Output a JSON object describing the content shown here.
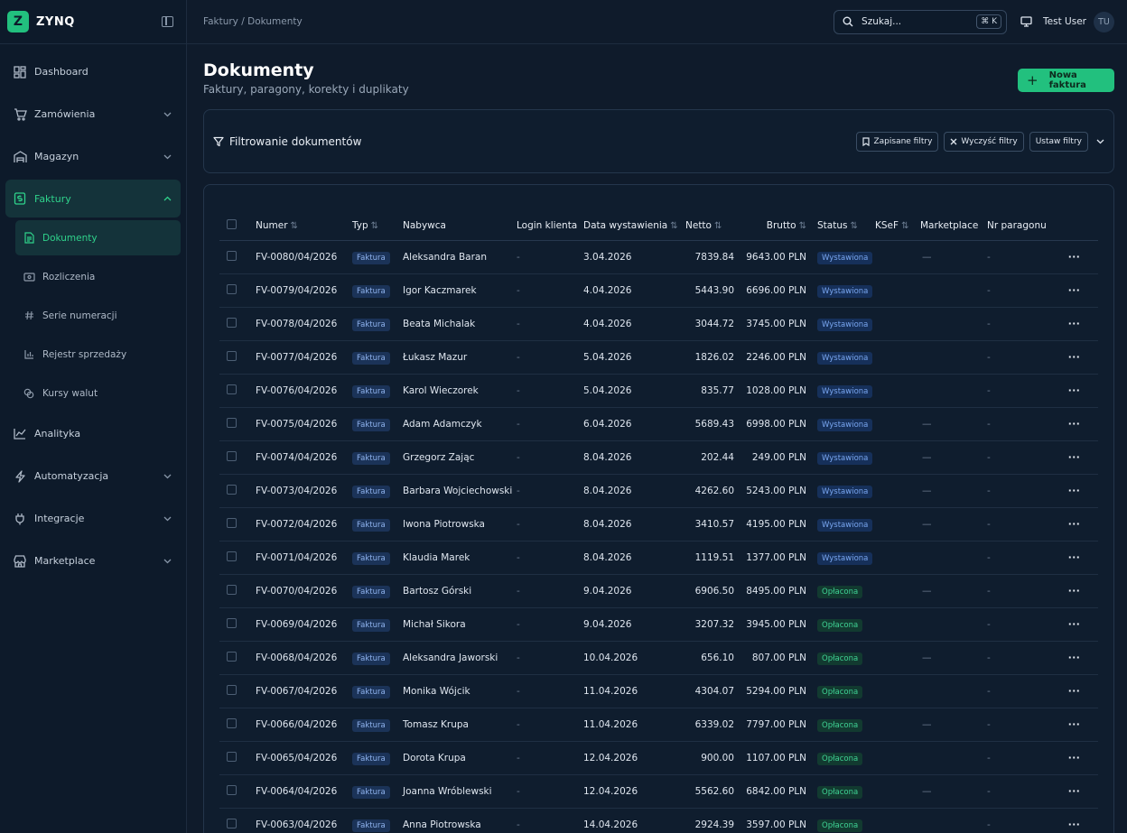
{
  "brand": {
    "logo_letter": "Z",
    "name": "ZYNQ"
  },
  "sidebar": {
    "items": [
      {
        "label": "Dashboard"
      },
      {
        "label": "Zamówienia"
      },
      {
        "label": "Magazyn"
      },
      {
        "label": "Faktury"
      },
      {
        "label": "Analityka"
      },
      {
        "label": "Automatyzacja"
      },
      {
        "label": "Integracje"
      },
      {
        "label": "Marketplace"
      }
    ],
    "subitems": [
      {
        "label": "Dokumenty"
      },
      {
        "label": "Rozliczenia"
      },
      {
        "label": "Serie numeracji"
      },
      {
        "label": "Rejestr sprzedaży"
      },
      {
        "label": "Kursy walut"
      }
    ]
  },
  "topbar": {
    "breadcrumb": "Faktury / Dokumenty",
    "search_placeholder": "Szukaj...",
    "search_shortcut": "⌘ K",
    "user_name": "Test User",
    "user_initials": "TU"
  },
  "page": {
    "title": "Dokumenty",
    "subtitle": "Faktury, paragony, korekty i duplikaty",
    "new_button": "Nowa faktura"
  },
  "filters": {
    "title": "Filtrowanie dokumentów",
    "saved": "Zapisane filtry",
    "clear": "Wyczyść filtry",
    "set": "Ustaw filtry"
  },
  "table": {
    "headers": {
      "numer": "Numer",
      "typ": "Typ",
      "nabywca": "Nabywca",
      "login": "Login klienta",
      "data": "Data wystawienia",
      "netto": "Netto",
      "brutto": "Brutto",
      "status": "Status",
      "ksef": "KSeF",
      "marketplace": "Marketplace",
      "paragon": "Nr paragonu"
    },
    "rows": [
      {
        "numer": "FV-0080/04/2026",
        "typ": "Faktura",
        "nabywca": "Aleksandra Baran",
        "login": "-",
        "data": "3.04.2026",
        "netto": "7839.84",
        "brutto": "9643.00 PLN",
        "status": "Wystawiona",
        "status_kind": "wyst",
        "marketplace": "—",
        "paragon": "-"
      },
      {
        "numer": "FV-0079/04/2026",
        "typ": "Faktura",
        "nabywca": "Igor Kaczmarek",
        "login": "-",
        "data": "4.04.2026",
        "netto": "5443.90",
        "brutto": "6696.00 PLN",
        "status": "Wystawiona",
        "status_kind": "wyst",
        "marketplace": "",
        "paragon": "-"
      },
      {
        "numer": "FV-0078/04/2026",
        "typ": "Faktura",
        "nabywca": "Beata Michalak",
        "login": "-",
        "data": "4.04.2026",
        "netto": "3044.72",
        "brutto": "3745.00 PLN",
        "status": "Wystawiona",
        "status_kind": "wyst",
        "marketplace": "",
        "paragon": "-"
      },
      {
        "numer": "FV-0077/04/2026",
        "typ": "Faktura",
        "nabywca": "Łukasz Mazur",
        "login": "-",
        "data": "5.04.2026",
        "netto": "1826.02",
        "brutto": "2246.00 PLN",
        "status": "Wystawiona",
        "status_kind": "wyst",
        "marketplace": "",
        "paragon": "-"
      },
      {
        "numer": "FV-0076/04/2026",
        "typ": "Faktura",
        "nabywca": "Karol Wieczorek",
        "login": "-",
        "data": "5.04.2026",
        "netto": "835.77",
        "brutto": "1028.00 PLN",
        "status": "Wystawiona",
        "status_kind": "wyst",
        "marketplace": "",
        "paragon": "-"
      },
      {
        "numer": "FV-0075/04/2026",
        "typ": "Faktura",
        "nabywca": "Adam Adamczyk",
        "login": "-",
        "data": "6.04.2026",
        "netto": "5689.43",
        "brutto": "6998.00 PLN",
        "status": "Wystawiona",
        "status_kind": "wyst",
        "marketplace": "—",
        "paragon": "-"
      },
      {
        "numer": "FV-0074/04/2026",
        "typ": "Faktura",
        "nabywca": "Grzegorz Zając",
        "login": "-",
        "data": "8.04.2026",
        "netto": "202.44",
        "brutto": "249.00 PLN",
        "status": "Wystawiona",
        "status_kind": "wyst",
        "marketplace": "—",
        "paragon": "-"
      },
      {
        "numer": "FV-0073/04/2026",
        "typ": "Faktura",
        "nabywca": "Barbara Wojciechowski",
        "login": "-",
        "data": "8.04.2026",
        "netto": "4262.60",
        "brutto": "5243.00 PLN",
        "status": "Wystawiona",
        "status_kind": "wyst",
        "marketplace": "—",
        "paragon": "-"
      },
      {
        "numer": "FV-0072/04/2026",
        "typ": "Faktura",
        "nabywca": "Iwona Piotrowska",
        "login": "-",
        "data": "8.04.2026",
        "netto": "3410.57",
        "brutto": "4195.00 PLN",
        "status": "Wystawiona",
        "status_kind": "wyst",
        "marketplace": "—",
        "paragon": "-"
      },
      {
        "numer": "FV-0071/04/2026",
        "typ": "Faktura",
        "nabywca": "Klaudia Marek",
        "login": "-",
        "data": "8.04.2026",
        "netto": "1119.51",
        "brutto": "1377.00 PLN",
        "status": "Wystawiona",
        "status_kind": "wyst",
        "marketplace": "",
        "paragon": "-"
      },
      {
        "numer": "FV-0070/04/2026",
        "typ": "Faktura",
        "nabywca": "Bartosz Górski",
        "login": "-",
        "data": "9.04.2026",
        "netto": "6906.50",
        "brutto": "8495.00 PLN",
        "status": "Opłacona",
        "status_kind": "opl",
        "marketplace": "—",
        "paragon": "-"
      },
      {
        "numer": "FV-0069/04/2026",
        "typ": "Faktura",
        "nabywca": "Michał Sikora",
        "login": "-",
        "data": "9.04.2026",
        "netto": "3207.32",
        "brutto": "3945.00 PLN",
        "status": "Opłacona",
        "status_kind": "opl",
        "marketplace": "",
        "paragon": "-"
      },
      {
        "numer": "FV-0068/04/2026",
        "typ": "Faktura",
        "nabywca": "Aleksandra Jaworski",
        "login": "-",
        "data": "10.04.2026",
        "netto": "656.10",
        "brutto": "807.00 PLN",
        "status": "Opłacona",
        "status_kind": "opl",
        "marketplace": "—",
        "paragon": "-"
      },
      {
        "numer": "FV-0067/04/2026",
        "typ": "Faktura",
        "nabywca": "Monika Wójcik",
        "login": "-",
        "data": "11.04.2026",
        "netto": "4304.07",
        "brutto": "5294.00 PLN",
        "status": "Opłacona",
        "status_kind": "opl",
        "marketplace": "",
        "paragon": "-"
      },
      {
        "numer": "FV-0066/04/2026",
        "typ": "Faktura",
        "nabywca": "Tomasz Krupa",
        "login": "-",
        "data": "11.04.2026",
        "netto": "6339.02",
        "brutto": "7797.00 PLN",
        "status": "Opłacona",
        "status_kind": "opl",
        "marketplace": "—",
        "paragon": "-"
      },
      {
        "numer": "FV-0065/04/2026",
        "typ": "Faktura",
        "nabywca": "Dorota Krupa",
        "login": "-",
        "data": "12.04.2026",
        "netto": "900.00",
        "brutto": "1107.00 PLN",
        "status": "Opłacona",
        "status_kind": "opl",
        "marketplace": "",
        "paragon": "-"
      },
      {
        "numer": "FV-0064/04/2026",
        "typ": "Faktura",
        "nabywca": "Joanna Wróblewski",
        "login": "-",
        "data": "12.04.2026",
        "netto": "5562.60",
        "brutto": "6842.00 PLN",
        "status": "Opłacona",
        "status_kind": "opl",
        "marketplace": "—",
        "paragon": "-"
      },
      {
        "numer": "FV-0063/04/2026",
        "typ": "Faktura",
        "nabywca": "Anna Piotrowska",
        "login": "-",
        "data": "14.04.2026",
        "netto": "2924.39",
        "brutto": "3597.00 PLN",
        "status": "Opłacona",
        "status_kind": "opl",
        "marketplace": "",
        "paragon": "-"
      }
    ],
    "row_action": "···"
  },
  "colors": {
    "accent": "#22c07e",
    "background": "#0f1b2b",
    "sidebar": "#0d1a2a",
    "active_bg": "#14333a"
  }
}
